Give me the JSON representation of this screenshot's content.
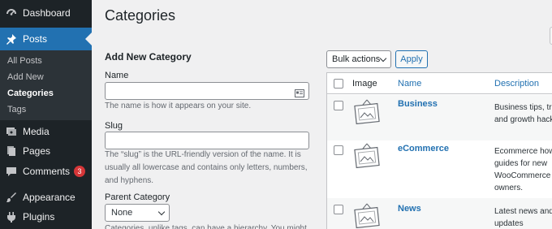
{
  "sidebar": {
    "items": [
      {
        "label": "Dashboard",
        "icon": "dashboard-icon"
      },
      {
        "label": "Posts",
        "icon": "pushpin-icon"
      },
      {
        "label": "Media",
        "icon": "media-icon"
      },
      {
        "label": "Pages",
        "icon": "pages-icon"
      },
      {
        "label": "Comments",
        "icon": "comments-icon",
        "badge": "3"
      },
      {
        "label": "Appearance",
        "icon": "paintbrush-icon"
      },
      {
        "label": "Plugins",
        "icon": "plug-icon"
      }
    ],
    "submenu": [
      "All Posts",
      "Add New",
      "Categories",
      "Tags"
    ],
    "active_color": "#2271b1"
  },
  "page": {
    "title": "Categories"
  },
  "form": {
    "heading": "Add New Category",
    "name_label": "Name",
    "name_help": "The name is how it appears on your site.",
    "slug_label": "Slug",
    "slug_help": "The “slug” is the URL-friendly version of the name. It is usually all lowercase and contains only letters, numbers, and hyphens.",
    "parent_label": "Parent Category",
    "parent_value": "None",
    "parent_help": "Categories, unlike tags, can have a hierarchy. You might"
  },
  "table": {
    "bulk_label": "Bulk actions",
    "apply_label": "Apply",
    "columns": [
      "Image",
      "Name",
      "Description"
    ],
    "rows": [
      {
        "name": "Business",
        "description": [
          "Business tips, tri",
          "and growth hack"
        ]
      },
      {
        "name": "eCommerce",
        "description": [
          "Ecommerce how",
          "guides for new",
          "WooCommerce s",
          "owners."
        ]
      },
      {
        "name": "News",
        "description": [
          "Latest news and",
          "updates"
        ]
      }
    ]
  }
}
